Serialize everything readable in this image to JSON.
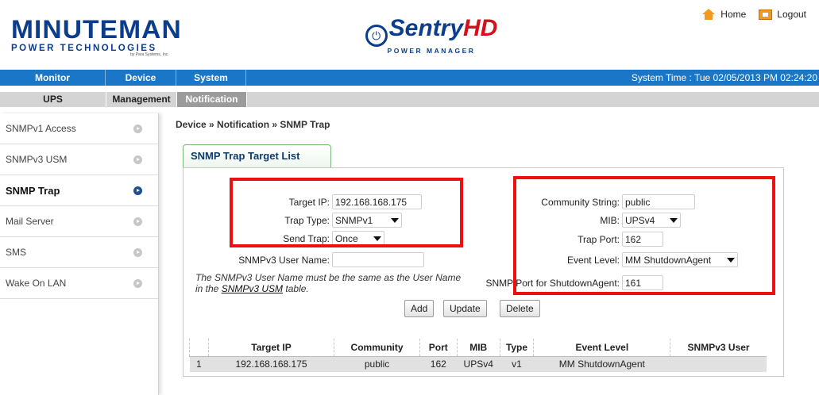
{
  "header": {
    "brand_word": "MINUTEMAN",
    "brand_sub": "POWER TECHNOLOGIES",
    "brand_tiny": "by Para Systems, Inc.",
    "product_main": "Sentry",
    "product_hd": "HD",
    "product_sub": "POWER MANAGER",
    "links": {
      "home": "Home",
      "logout": "Logout"
    }
  },
  "nav_primary": {
    "tabs": [
      {
        "label": "Monitor"
      },
      {
        "label": "Device"
      },
      {
        "label": "System"
      }
    ],
    "system_time": "System Time : Tue 02/05/2013 PM 02:24:20"
  },
  "nav_secondary": {
    "tabs": [
      {
        "label": "UPS"
      },
      {
        "label": "Management"
      },
      {
        "label": "Notification"
      }
    ]
  },
  "sidebar": {
    "items": [
      {
        "label": "SNMPv1 Access"
      },
      {
        "label": "SNMPv3 USM"
      },
      {
        "label": "SNMP Trap"
      },
      {
        "label": "Mail Server"
      },
      {
        "label": "SMS"
      },
      {
        "label": "Wake On LAN"
      }
    ]
  },
  "breadcrumb": "Device » Notification » SNMP Trap",
  "panel": {
    "tab_label": "SNMP Trap Target List",
    "target_ip": {
      "label": "Target IP:",
      "value": "192.168.168.175"
    },
    "trap_type": {
      "label": "Trap Type:",
      "value": "SNMPv1"
    },
    "send_trap": {
      "label": "Send Trap:",
      "value": "Once"
    },
    "snmpv3_user": {
      "label": "SNMPv3 User Name:",
      "value": ""
    },
    "note_text": "The SNMPv3 User Name must be the same as the User Name in the",
    "note_link": "SNMPv3 USM",
    "note_suffix": "table.",
    "community": {
      "label": "Community String:",
      "value": "public"
    },
    "mib": {
      "label": "MIB:",
      "value": "UPSv4"
    },
    "trap_port": {
      "label": "Trap Port:",
      "value": "162"
    },
    "event_level": {
      "label": "Event Level:",
      "value": "MM ShutdownAgent"
    },
    "shutdown_port": {
      "label": "SNMP Port for ShutdownAgent:",
      "value": "161"
    },
    "buttons": {
      "add": "Add",
      "update": "Update",
      "delete": "Delete"
    }
  },
  "table": {
    "headers": [
      "",
      "Target IP",
      "Community",
      "Port",
      "MIB",
      "Type",
      "Event Level",
      "SNMPv3 User"
    ],
    "rows": [
      [
        "1",
        "192.168.168.175",
        "public",
        "162",
        "UPSv4",
        "v1",
        "MM ShutdownAgent",
        ""
      ]
    ]
  },
  "colors": {
    "nav_blue": "#1a77c7",
    "highlight_red": "#ee1010",
    "brand_blue": "#0b3d8c",
    "active_tab_gray": "#9b9b9b"
  }
}
